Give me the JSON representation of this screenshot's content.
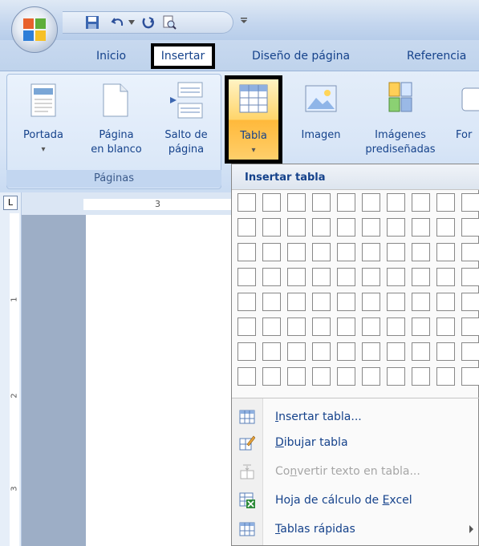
{
  "tabs": [
    "Inicio",
    "Insertar",
    "Diseño de página",
    "Referencia"
  ],
  "ribbon": {
    "buttons": [
      {
        "line1": "Portada",
        "line2": "▾"
      },
      {
        "line1": "Página",
        "line2": "en blanco"
      },
      {
        "line1": "Salto de",
        "line2": "página"
      },
      {
        "line1": "Tabla",
        "line2": "▾"
      },
      {
        "line1": "Imagen",
        "line2": ""
      },
      {
        "line1": "Imágenes",
        "line2": "prediseñadas"
      },
      {
        "line1": "For",
        "line2": ""
      }
    ],
    "group_label": "Páginas"
  },
  "ruler": {
    "corner": "L",
    "h_mark": "3",
    "v_marks": [
      "1",
      "2",
      "3"
    ]
  },
  "dropdown": {
    "header": "Insertar tabla",
    "grid": {
      "columns": 10,
      "rows": 8
    },
    "menu": [
      {
        "pre": "",
        "key": "I",
        "post": "nsertar tabla...",
        "enabled": true,
        "submenu": false
      },
      {
        "pre": "",
        "key": "D",
        "post": "ibujar tabla",
        "enabled": true,
        "submenu": false
      },
      {
        "pre": "Co",
        "key": "n",
        "post": "vertir texto en tabla...",
        "enabled": false,
        "submenu": false
      },
      {
        "pre": "Hoja de cálculo de ",
        "key": "E",
        "post": "xcel",
        "enabled": true,
        "submenu": false
      },
      {
        "pre": "",
        "key": "T",
        "post": "ablas rápidas",
        "enabled": true,
        "submenu": true
      }
    ]
  },
  "colors": {
    "accent": "#15428b",
    "ribbon": "#d9e6f7",
    "highlight": "#ffd56b",
    "disabled": "#a6a6a6"
  }
}
